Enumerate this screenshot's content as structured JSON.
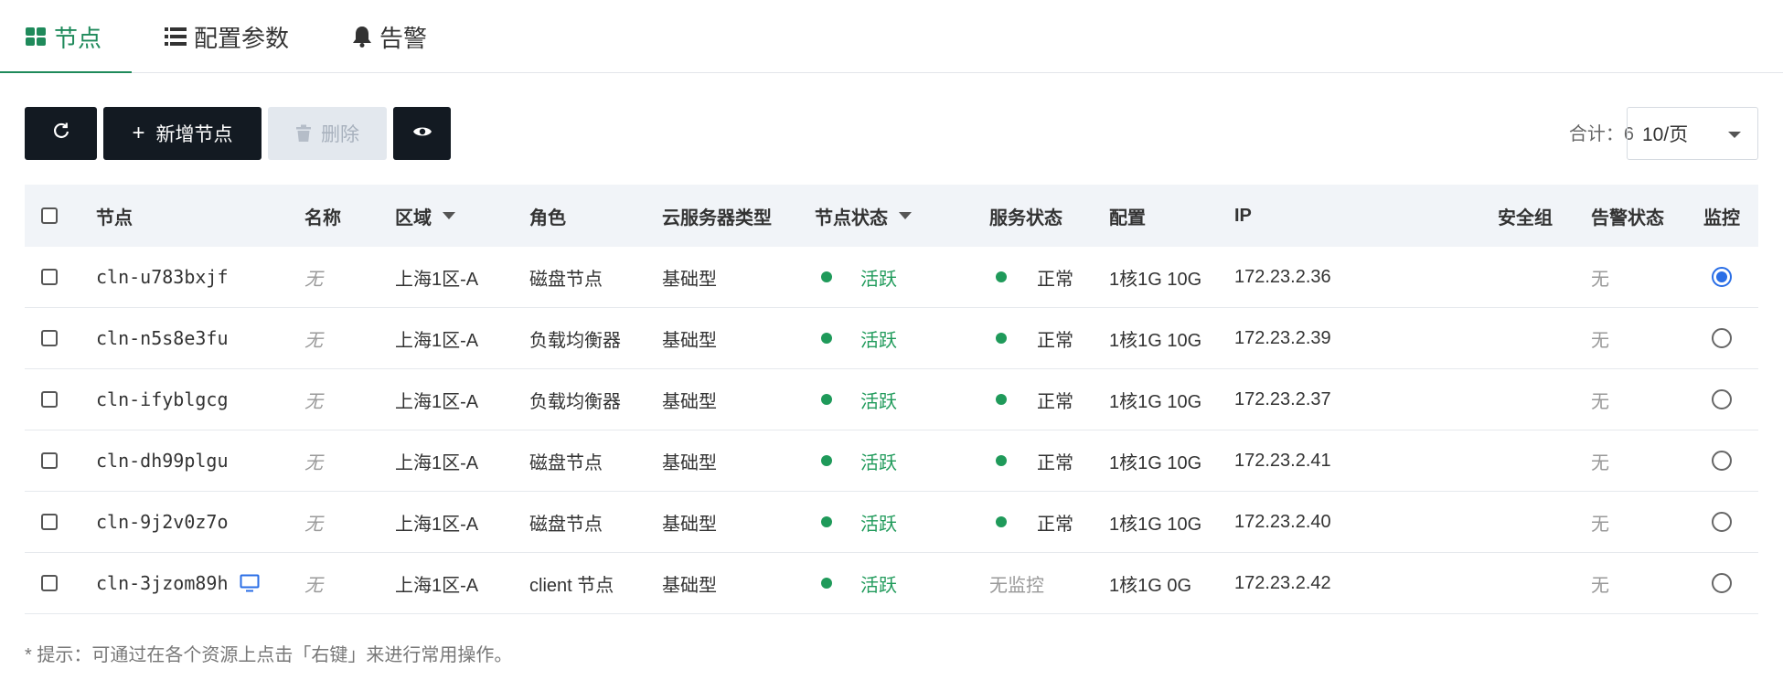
{
  "tabs": [
    {
      "label": "节点",
      "icon": "grid-icon",
      "active": true
    },
    {
      "label": "配置参数",
      "icon": "list-icon",
      "active": false
    },
    {
      "label": "告警",
      "icon": "bell-icon",
      "active": false
    }
  ],
  "toolbar": {
    "add_label": "新增节点",
    "delete_label": "删除",
    "total_label": "合计：6",
    "page_size": "10/页"
  },
  "table": {
    "headers": {
      "node": "节点",
      "name": "名称",
      "region": "区域",
      "role": "角色",
      "server_type": "云服务器类型",
      "node_status": "节点状态",
      "service_status": "服务状态",
      "config": "配置",
      "ip": "IP",
      "security_group": "安全组",
      "alert_status": "告警状态",
      "monitor": "监控"
    },
    "rows": [
      {
        "node": "cln-u783bxjf",
        "name": "无",
        "region": "上海1区-A",
        "role": "磁盘节点",
        "server_type": "基础型",
        "node_status": "活跃",
        "service_status": "正常",
        "config": "1核1G 10G",
        "ip": "172.23.2.36",
        "alert": "无"
      },
      {
        "node": "cln-n5s8e3fu",
        "name": "无",
        "region": "上海1区-A",
        "role": "负载均衡器",
        "server_type": "基础型",
        "node_status": "活跃",
        "service_status": "正常",
        "config": "1核1G 10G",
        "ip": "172.23.2.39",
        "alert": "无"
      },
      {
        "node": "cln-ifyblgcg",
        "name": "无",
        "region": "上海1区-A",
        "role": "负载均衡器",
        "server_type": "基础型",
        "node_status": "活跃",
        "service_status": "正常",
        "config": "1核1G 10G",
        "ip": "172.23.2.37",
        "alert": "无"
      },
      {
        "node": "cln-dh99plgu",
        "name": "无",
        "region": "上海1区-A",
        "role": "磁盘节点",
        "server_type": "基础型",
        "node_status": "活跃",
        "service_status": "正常",
        "config": "1核1G 10G",
        "ip": "172.23.2.41",
        "alert": "无"
      },
      {
        "node": "cln-9j2v0z7o",
        "name": "无",
        "region": "上海1区-A",
        "role": "磁盘节点",
        "server_type": "基础型",
        "node_status": "活跃",
        "service_status": "正常",
        "config": "1核1G 10G",
        "ip": "172.23.2.40",
        "alert": "无"
      },
      {
        "node": "cln-3jzom89h",
        "name": "无",
        "region": "上海1区-A",
        "role": "client 节点",
        "server_type": "基础型",
        "node_status": "活跃",
        "service_status": "无监控",
        "config": "1核1G 0G",
        "ip": "172.23.2.42",
        "alert": "无"
      }
    ]
  },
  "hint": "* 提示：可通过在各个资源上点击「右键」来进行常用操作。",
  "colors": {
    "accent": "#1f8a5b",
    "status_green": "#1f9a5a",
    "selected_blue": "#2a6ee6",
    "dark_button": "#131a22"
  }
}
